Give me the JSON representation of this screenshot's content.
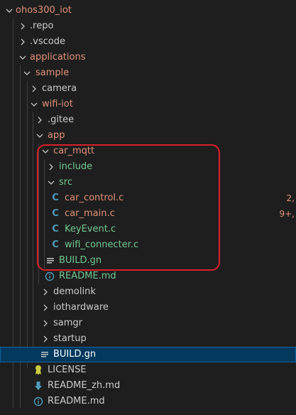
{
  "colors": {
    "modified": "#e2927b",
    "untracked": "#73c991",
    "default": "#cccccc",
    "c_icon": "#519aba",
    "selection": "#04395e",
    "highlight_box": "#d9202b"
  },
  "tree": {
    "root": {
      "label": "ohos300_iot"
    },
    "repo": {
      "label": ".repo"
    },
    "vscode": {
      "label": ".vscode"
    },
    "applications": {
      "label": "applications"
    },
    "sample": {
      "label": "sample"
    },
    "camera": {
      "label": "camera"
    },
    "wifi_iot": {
      "label": "wifi-iot"
    },
    "gitee": {
      "label": ".gitee"
    },
    "app": {
      "label": "app"
    },
    "car_mqtt": {
      "label": "car_mqtt"
    },
    "include": {
      "label": "include"
    },
    "src": {
      "label": "src"
    },
    "car_control": {
      "label": "car_control.c",
      "icon": "C",
      "badge": "2,"
    },
    "car_main": {
      "label": "car_main.c",
      "icon": "C",
      "badge": "9+,"
    },
    "keyevent": {
      "label": "KeyEvent.c",
      "icon": "C"
    },
    "wifi_connecter": {
      "label": "wifi_connecter.c",
      "icon": "C"
    },
    "build_gn_inner": {
      "label": "BUILD.gn",
      "icon": "lines-icon"
    },
    "readme_md_inner": {
      "label": "README.md",
      "icon": "info-icon"
    },
    "demolink": {
      "label": "demolink"
    },
    "iothardware": {
      "label": "iothardware"
    },
    "samgr": {
      "label": "samgr"
    },
    "startup": {
      "label": "startup"
    },
    "build_gn_selected": {
      "label": "BUILD.gn",
      "icon": "lines-icon"
    },
    "license": {
      "label": "LICENSE",
      "icon": "license-icon"
    },
    "readme_zh": {
      "label": "README_zh.md",
      "icon": "download-arrow-icon"
    },
    "readme_md": {
      "label": "README.md",
      "icon": "info-icon"
    }
  }
}
